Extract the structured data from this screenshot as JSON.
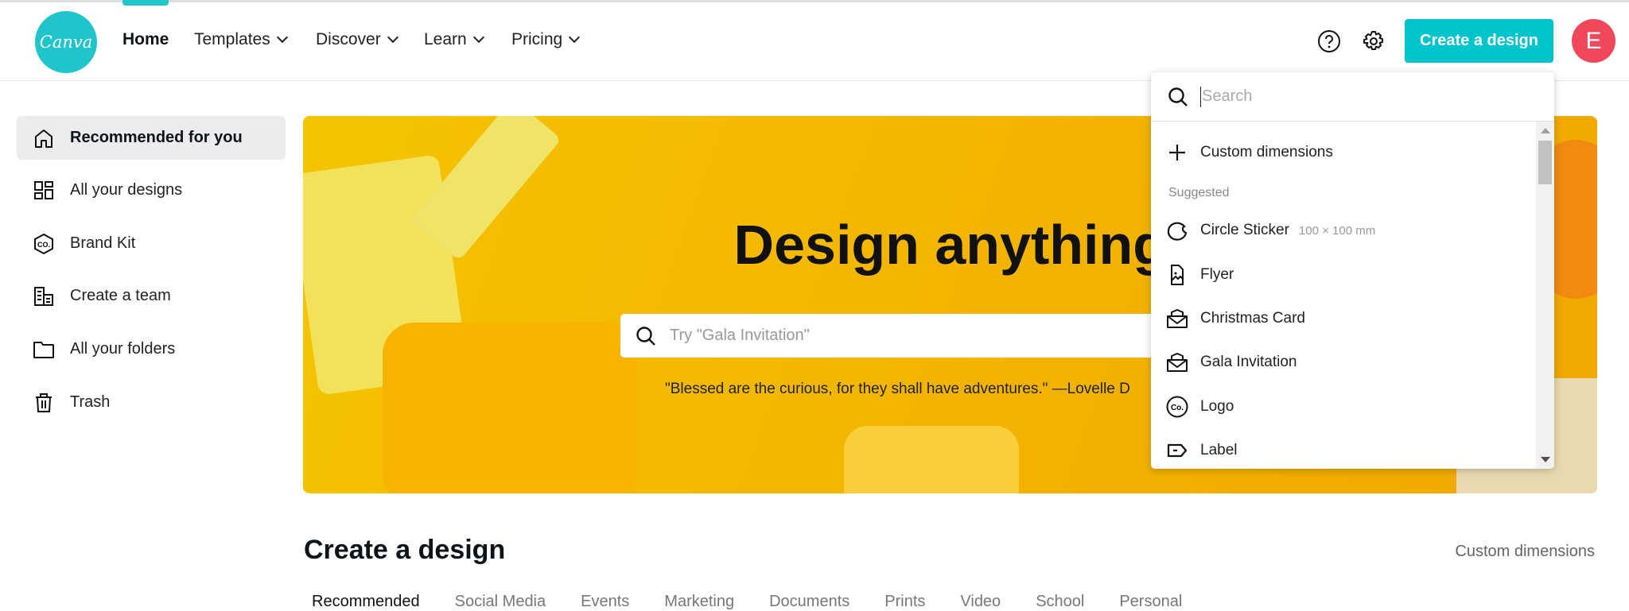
{
  "header": {
    "logo_text": "Canva",
    "nav": [
      {
        "label": "Home",
        "active": true
      },
      {
        "label": "Templates"
      },
      {
        "label": "Discover"
      },
      {
        "label": "Learn"
      },
      {
        "label": "Pricing"
      }
    ],
    "create_button": "Create a design",
    "avatar_initial": "E",
    "accent_color": "#00c4cc",
    "avatar_color": "#f0475a"
  },
  "sidebar": {
    "items": [
      {
        "label": "Recommended for you",
        "icon": "home-icon",
        "active": true
      },
      {
        "label": "All your designs",
        "icon": "grid-icon"
      },
      {
        "label": "Brand Kit",
        "icon": "brand-kit-icon"
      },
      {
        "label": "Create a team",
        "icon": "building-icon"
      },
      {
        "label": "All your folders",
        "icon": "folder-icon"
      },
      {
        "label": "Trash",
        "icon": "trash-icon"
      }
    ]
  },
  "hero": {
    "title": "Design anything.",
    "search_placeholder": "Try \"Gala Invitation\"",
    "quote": "\"Blessed are the curious, for they shall have adventures.\" —Lovelle D"
  },
  "create_section": {
    "title": "Create a design",
    "custom_dimensions": "Custom dimensions",
    "tabs": [
      "Recommended",
      "Social Media",
      "Events",
      "Marketing",
      "Documents",
      "Prints",
      "Video",
      "School",
      "Personal"
    ]
  },
  "dropdown": {
    "search_placeholder": "Search",
    "custom_dimensions": "Custom dimensions",
    "suggested_label": "Suggested",
    "items": [
      {
        "label": "Circle Sticker",
        "dims": "100 × 100 mm",
        "icon": "circle-sticker-icon"
      },
      {
        "label": "Flyer",
        "icon": "flyer-icon"
      },
      {
        "label": "Christmas Card",
        "icon": "card-icon"
      },
      {
        "label": "Gala Invitation",
        "icon": "invitation-icon"
      },
      {
        "label": "Logo",
        "icon": "logo-icon"
      },
      {
        "label": "Label",
        "icon": "label-icon"
      }
    ]
  }
}
